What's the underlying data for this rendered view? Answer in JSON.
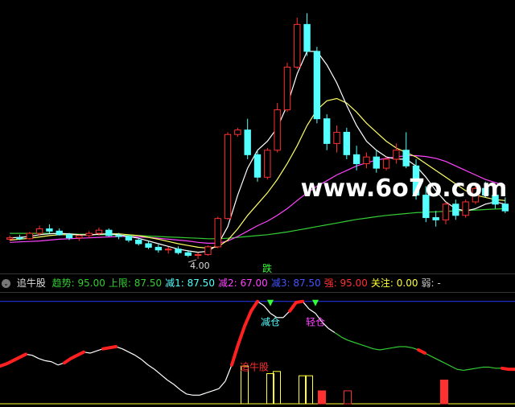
{
  "chart_data": [
    {
      "type": "candlestick",
      "title": "",
      "min_price_label": "4.00",
      "event_label": "跌",
      "watermark": "www.6o7o.com",
      "colors": {
        "up": "#ff3030",
        "down": "#54ffff",
        "ma_fast": "#ffffff",
        "ma_mid": "#ffff66",
        "ma_slow": "#ff44ff",
        "ma_long": "#33cc33"
      },
      "candles": [
        [
          4.42,
          4.5,
          4.38,
          4.45
        ],
        [
          4.45,
          4.52,
          4.4,
          4.43
        ],
        [
          4.43,
          4.58,
          4.41,
          4.55
        ],
        [
          4.55,
          4.72,
          4.5,
          4.65
        ],
        [
          4.65,
          4.75,
          4.55,
          4.6
        ],
        [
          4.6,
          4.66,
          4.5,
          4.52
        ],
        [
          4.52,
          4.56,
          4.4,
          4.45
        ],
        [
          4.45,
          4.52,
          4.38,
          4.5
        ],
        [
          4.5,
          4.6,
          4.45,
          4.55
        ],
        [
          4.55,
          4.68,
          4.5,
          4.62
        ],
        [
          4.62,
          4.66,
          4.48,
          4.5
        ],
        [
          4.5,
          4.56,
          4.42,
          4.48
        ],
        [
          4.48,
          4.52,
          4.35,
          4.4
        ],
        [
          4.4,
          4.45,
          4.28,
          4.32
        ],
        [
          4.32,
          4.38,
          4.2,
          4.24
        ],
        [
          4.24,
          4.3,
          4.12,
          4.18
        ],
        [
          4.18,
          4.25,
          4.1,
          4.2
        ],
        [
          4.2,
          4.26,
          4.08,
          4.12
        ],
        [
          4.12,
          4.18,
          4.02,
          4.06
        ],
        [
          4.06,
          4.12,
          3.98,
          4.08
        ],
        [
          4.08,
          4.28,
          4.05,
          4.25
        ],
        [
          4.25,
          4.92,
          4.22,
          4.88
        ],
        [
          4.88,
          6.8,
          4.85,
          6.75
        ],
        [
          6.75,
          6.9,
          6.7,
          6.85
        ],
        [
          6.85,
          7.1,
          6.2,
          6.3
        ],
        [
          6.3,
          6.4,
          5.7,
          5.8
        ],
        [
          5.8,
          6.45,
          5.75,
          6.4
        ],
        [
          6.4,
          7.45,
          6.35,
          7.3
        ],
        [
          7.3,
          8.35,
          7.25,
          8.25
        ],
        [
          8.25,
          9.35,
          8.2,
          9.2
        ],
        [
          9.2,
          9.45,
          8.5,
          8.6
        ],
        [
          8.6,
          8.7,
          7.0,
          7.1
        ],
        [
          7.1,
          7.2,
          6.4,
          6.55
        ],
        [
          6.55,
          6.95,
          6.35,
          6.8
        ],
        [
          6.8,
          6.9,
          6.2,
          6.3
        ],
        [
          6.3,
          6.5,
          5.95,
          6.1
        ],
        [
          6.1,
          6.35,
          6.0,
          6.25
        ],
        [
          6.25,
          6.4,
          5.9,
          6.0
        ],
        [
          6.0,
          6.25,
          5.95,
          6.2
        ],
        [
          6.2,
          6.55,
          6.1,
          6.4
        ],
        [
          6.4,
          6.8,
          6.0,
          6.05
        ],
        [
          6.05,
          6.2,
          5.3,
          5.4
        ],
        [
          5.4,
          5.6,
          4.8,
          4.9
        ],
        [
          4.9,
          5.05,
          4.7,
          4.85
        ],
        [
          4.85,
          5.25,
          4.75,
          5.2
        ],
        [
          5.2,
          5.3,
          4.85,
          4.95
        ],
        [
          4.95,
          5.3,
          4.9,
          5.25
        ],
        [
          5.25,
          5.6,
          5.2,
          5.55
        ],
        [
          5.55,
          5.7,
          5.35,
          5.4
        ],
        [
          5.4,
          5.55,
          5.1,
          5.2
        ],
        [
          5.2,
          5.35,
          5.0,
          5.05
        ]
      ],
      "ma_fast": [
        4.45,
        4.46,
        4.48,
        4.52,
        4.54,
        4.55,
        4.54,
        4.52,
        4.51,
        4.53,
        4.54,
        4.52,
        4.48,
        4.44,
        4.38,
        4.32,
        4.26,
        4.2,
        4.16,
        4.13,
        4.15,
        4.3,
        4.7,
        5.4,
        6.0,
        6.4,
        6.6,
        6.9,
        7.4,
        8.1,
        8.6,
        8.6,
        8.3,
        7.9,
        7.4,
        6.95,
        6.6,
        6.4,
        6.25,
        6.2,
        6.2,
        6.05,
        5.8,
        5.5,
        5.25,
        5.1,
        5.05,
        5.1,
        5.2,
        5.25,
        5.2
      ],
      "ma_mid": [
        4.4,
        4.42,
        4.44,
        4.47,
        4.5,
        4.52,
        4.52,
        4.52,
        4.52,
        4.53,
        4.54,
        4.54,
        4.52,
        4.5,
        4.46,
        4.42,
        4.37,
        4.32,
        4.28,
        4.24,
        4.22,
        4.25,
        4.4,
        4.65,
        4.95,
        5.2,
        5.45,
        5.75,
        6.1,
        6.5,
        6.95,
        7.3,
        7.5,
        7.55,
        7.45,
        7.25,
        7.0,
        6.8,
        6.6,
        6.45,
        6.35,
        6.25,
        6.1,
        5.95,
        5.8,
        5.65,
        5.5,
        5.4,
        5.35,
        5.3,
        5.28
      ],
      "ma_slow": [
        4.35,
        4.36,
        4.37,
        4.38,
        4.4,
        4.42,
        4.43,
        4.44,
        4.45,
        4.46,
        4.47,
        4.48,
        4.48,
        4.47,
        4.46,
        4.44,
        4.42,
        4.4,
        4.38,
        4.35,
        4.33,
        4.33,
        4.38,
        4.48,
        4.6,
        4.72,
        4.82,
        4.95,
        5.1,
        5.28,
        5.45,
        5.6,
        5.72,
        5.85,
        5.95,
        6.05,
        6.12,
        6.18,
        6.22,
        6.25,
        6.28,
        6.28,
        6.26,
        6.22,
        6.15,
        6.05,
        5.95,
        5.85,
        5.75,
        5.68,
        5.62
      ],
      "ma_long": [
        4.55,
        4.55,
        4.55,
        4.55,
        4.55,
        4.54,
        4.54,
        4.53,
        4.53,
        4.52,
        4.52,
        4.51,
        4.5,
        4.5,
        4.49,
        4.48,
        4.47,
        4.46,
        4.45,
        4.44,
        4.43,
        4.43,
        4.44,
        4.46,
        4.48,
        4.5,
        4.52,
        4.55,
        4.58,
        4.62,
        4.66,
        4.7,
        4.74,
        4.78,
        4.82,
        4.86,
        4.89,
        4.92,
        4.95,
        4.97,
        4.99,
        5.01,
        5.02,
        5.03,
        5.04,
        5.05,
        5.06,
        5.07,
        5.08,
        5.09,
        5.1
      ]
    },
    {
      "type": "line",
      "title": "追牛股",
      "indicators": [
        {
          "label": "趋势:",
          "value": "95.00",
          "color": "#33cc33"
        },
        {
          "label": "上限:",
          "value": "87.50",
          "color": "#33cc33"
        },
        {
          "label": "减1:",
          "value": "87.50",
          "color": "#54ffff"
        },
        {
          "label": "减2:",
          "value": "67.00",
          "color": "#ff44ff"
        },
        {
          "label": "减3:",
          "value": "87.50",
          "color": "#4455ff"
        },
        {
          "label": "强:",
          "value": "95.00",
          "color": "#ff3030"
        },
        {
          "label": "关注:",
          "value": "0.00",
          "color": "#ffff33"
        },
        {
          "label": "弱:",
          "value": "-",
          "color": "#cccccc"
        }
      ],
      "ylim": [
        0,
        100
      ],
      "upper_line": 95,
      "signals": [
        {
          "text": "减仓",
          "index": 30,
          "color": "#54ffff"
        },
        {
          "text": "轻仓",
          "index": 35,
          "color": "#ff44ff"
        },
        {
          "text": "追牛股",
          "index": 26,
          "color": "#ff3030"
        }
      ],
      "values": [
        35,
        37,
        40,
        43,
        46,
        45,
        42,
        40,
        39,
        36,
        38,
        42,
        45,
        48,
        47,
        49,
        51,
        52,
        53,
        51,
        48,
        45,
        41,
        36,
        32,
        27,
        22,
        18,
        13,
        9,
        8,
        8,
        10,
        12,
        14,
        21,
        36,
        55,
        72,
        86,
        95,
        91,
        84,
        80,
        80,
        86,
        94,
        95,
        88,
        84,
        76,
        70,
        66,
        62,
        59,
        57,
        55,
        53,
        51,
        50,
        51,
        52,
        53,
        53,
        52,
        50,
        47,
        44,
        41,
        38,
        35,
        32,
        31,
        32,
        33,
        34,
        34,
        33,
        33,
        32,
        32
      ],
      "highlight_ranges": [
        [
          0,
          4
        ],
        [
          10,
          13
        ],
        [
          16,
          18
        ],
        [
          36,
          40
        ],
        [
          45,
          47
        ],
        [
          65,
          66
        ],
        [
          78,
          80
        ]
      ],
      "bars": [
        {
          "index": 38,
          "value": 35,
          "color": "#ffff33"
        },
        {
          "index": 42,
          "value": 28,
          "color": "#ffff33"
        },
        {
          "index": 43,
          "value": 30,
          "color": "#ffff33"
        },
        {
          "index": 47,
          "value": 26,
          "color": "#ffff33"
        },
        {
          "index": 48,
          "value": 26,
          "color": "#ffff33"
        },
        {
          "index": 50,
          "value": 12,
          "color": "#ff3030",
          "fill": true
        },
        {
          "index": 54,
          "value": 12,
          "color": "#ff3030"
        },
        {
          "index": 69,
          "value": 22,
          "color": "#ff3030",
          "fill": true
        }
      ]
    }
  ]
}
